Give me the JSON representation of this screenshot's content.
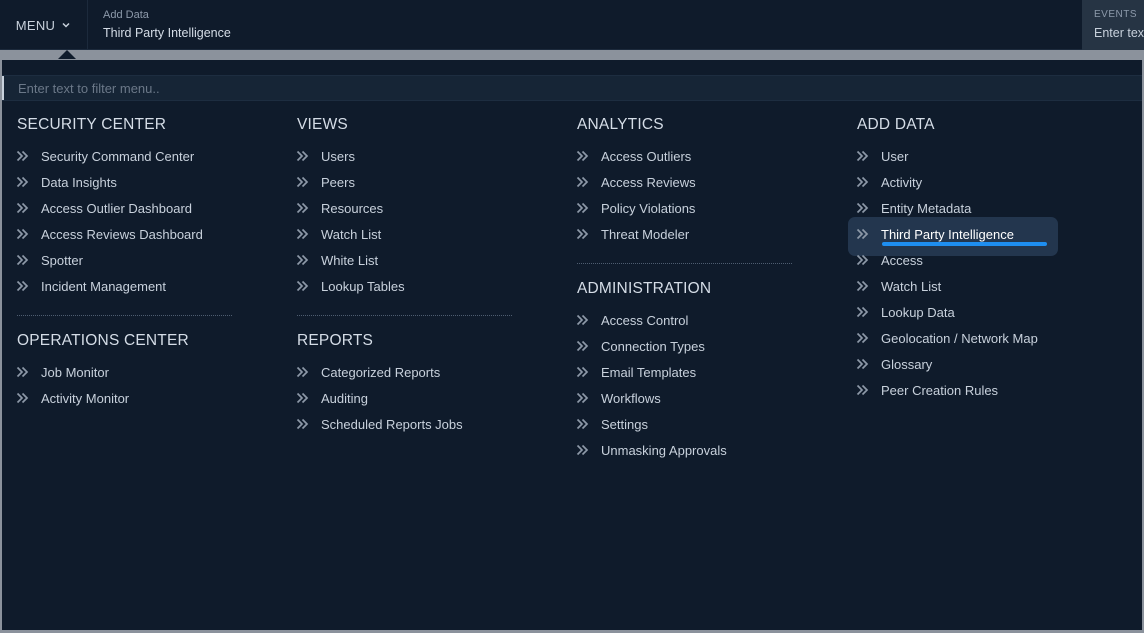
{
  "topbar": {
    "menu_label": "MENU",
    "breadcrumb_label": "Add Data",
    "breadcrumb_value": "Third Party Intelligence",
    "events_label": "EVENTS",
    "events_placeholder": "Enter text"
  },
  "menu": {
    "filter_placeholder": "Enter text to filter menu..",
    "sections": {
      "security_center": {
        "title": "SECURITY CENTER",
        "items": [
          "Security Command Center",
          "Data Insights",
          "Access Outlier Dashboard",
          "Access Reviews Dashboard",
          "Spotter",
          "Incident Management"
        ]
      },
      "operations_center": {
        "title": "OPERATIONS CENTER",
        "items": [
          "Job Monitor",
          "Activity Monitor"
        ]
      },
      "views": {
        "title": "VIEWS",
        "items": [
          "Users",
          "Peers",
          "Resources",
          "Watch List",
          "White List",
          "Lookup Tables"
        ]
      },
      "reports": {
        "title": "REPORTS",
        "items": [
          "Categorized Reports",
          "Auditing",
          "Scheduled Reports Jobs"
        ]
      },
      "analytics": {
        "title": "ANALYTICS",
        "items": [
          "Access Outliers",
          "Access Reviews",
          "Policy Violations",
          "Threat Modeler"
        ]
      },
      "administration": {
        "title": "ADMINISTRATION",
        "items": [
          "Access Control",
          "Connection Types",
          "Email Templates",
          "Workflows",
          "Settings",
          "Unmasking Approvals"
        ]
      },
      "add_data": {
        "title": "ADD DATA",
        "items": [
          "User",
          "Activity",
          "Entity Metadata",
          "Third Party Intelligence",
          "Access",
          "Watch List",
          "Lookup Data",
          "Geolocation / Network Map",
          "Glossary",
          "Peer Creation Rules"
        ],
        "selected": "Third Party Intelligence"
      }
    }
  },
  "colors": {
    "background": "#0f1b2b",
    "accent": "#1e8ef0",
    "selected_bg": "#23364e"
  },
  "icons": {
    "menu_item": "double-chevron-right-icon",
    "menu_toggle": "chevron-down-icon"
  }
}
